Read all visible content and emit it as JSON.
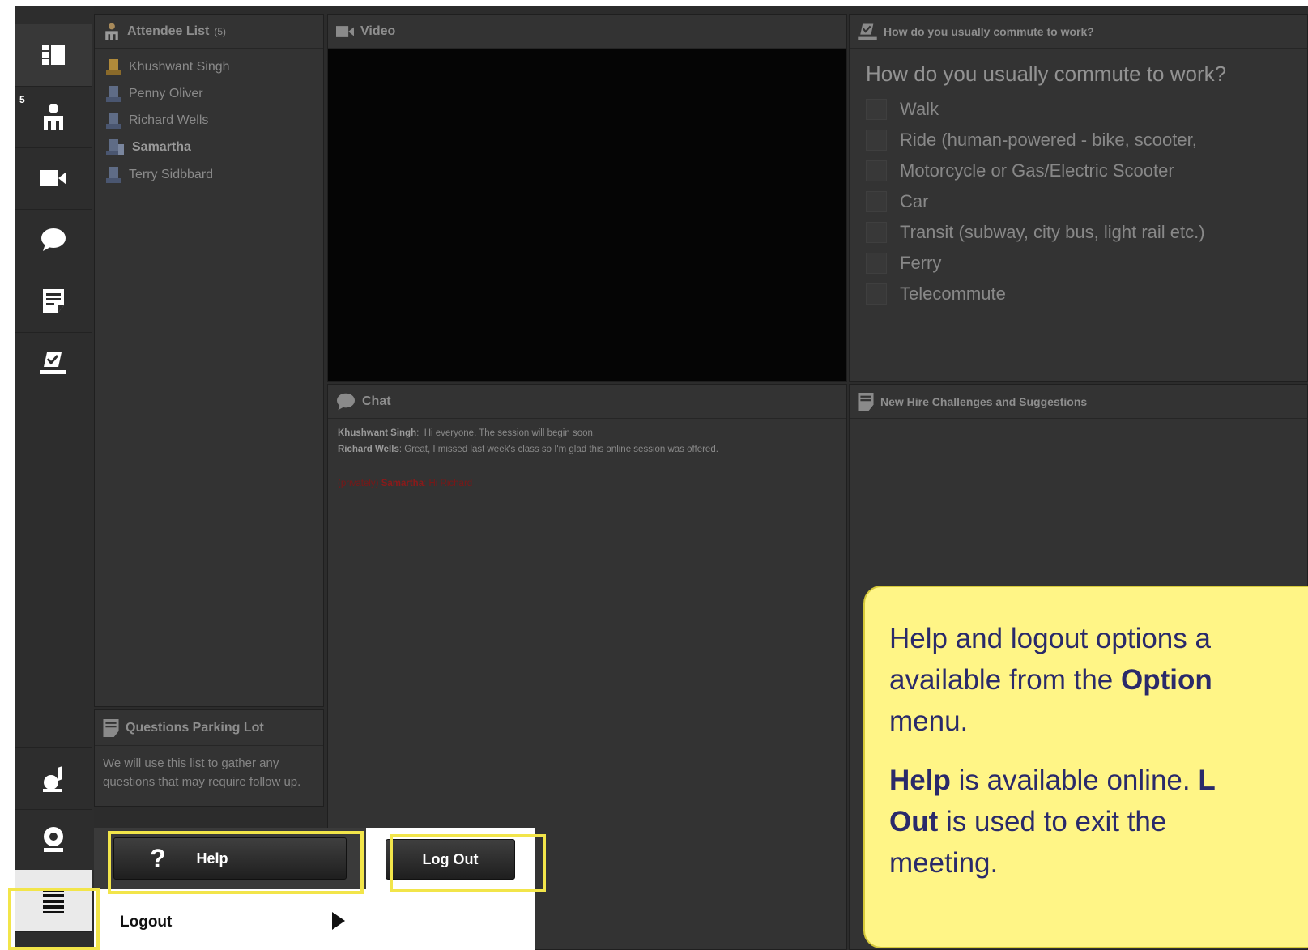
{
  "toolbar": {
    "badge_count": "5",
    "buttons": [
      "layouts-icon",
      "attendees-icon",
      "video-icon",
      "chat-icon",
      "notes-icon",
      "poll-icon",
      "raise-hand-icon",
      "webcam-icon",
      "options-menu-icon"
    ]
  },
  "attendees": {
    "title": "Attendee List",
    "count": "(5)",
    "list": [
      {
        "name": "Khushwant Singh"
      },
      {
        "name": "Penny Oliver"
      },
      {
        "name": "Richard Wells"
      },
      {
        "name": "Samartha"
      },
      {
        "name": "Terry Sidbbard"
      }
    ]
  },
  "parking_lot": {
    "title": "Questions Parking Lot",
    "text": "We will use this list to gather any questions that may require follow up."
  },
  "video": {
    "title": "Video"
  },
  "chat": {
    "title": "Chat",
    "messages": [
      {
        "sender": "Khushwant Singh",
        "text": "Hi everyone. The session will begin soon."
      },
      {
        "sender": "Richard Wells",
        "text": "Great, I missed last week's class so I'm glad this online session was offered."
      },
      {
        "prefix": "(privately)",
        "sender": "Samartha",
        "text": "Hi Richard"
      }
    ]
  },
  "poll": {
    "title": "How do you usually commute to work?",
    "question": "How do you usually commute to work?",
    "options": [
      "Walk",
      "Ride (human-powered - bike, scooter,",
      "Motorcycle or Gas/Electric Scooter",
      "Car",
      "Transit (subway, city bus, light rail etc.)",
      "Ferry",
      "Telecommute"
    ]
  },
  "notes": {
    "title": "New Hire Challenges and Suggestions"
  },
  "options_menu": {
    "help_label": "Help",
    "help_glyph": "?",
    "logout_label": "Log Out",
    "logout_item": "Logout"
  },
  "callout": {
    "p1_a": "Help and logout options a",
    "p1_b": "available from the ",
    "p1_bold": "Option",
    "p1_c": "menu.",
    "p2_bold1": "Help",
    "p2_a": " is available online. ",
    "p2_bold2": "L",
    "p2_bold3": "Out",
    "p2_b": " is used to exit the",
    "p2_c": "meeting."
  },
  "colors": {
    "highlight": "#f2e54a",
    "callout_bg": "#fff586",
    "callout_text": "#2a2a6a",
    "private_msg": "#7a1717"
  }
}
